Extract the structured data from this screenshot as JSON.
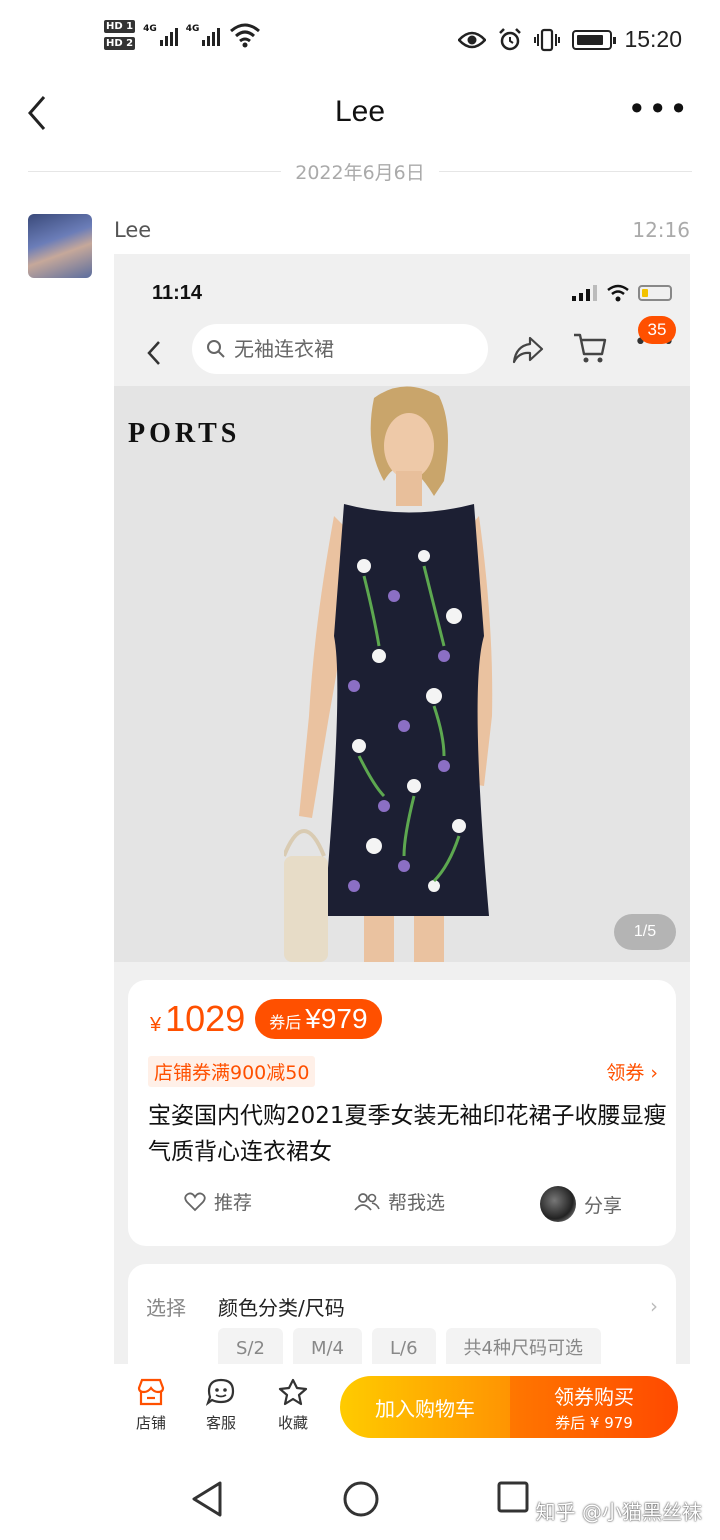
{
  "status_bar": {
    "hd1": "HD 1",
    "hd2": "HD 2",
    "net1": "4G",
    "net2": "4G",
    "time": "15:20",
    "icons": [
      "eye-icon",
      "alarm-icon",
      "vibrate-icon",
      "battery-icon"
    ]
  },
  "chat": {
    "title": "Lee",
    "date_divider": "2022年6月6日",
    "sender": "Lee",
    "message_time": "12:16"
  },
  "shared_screenshot": {
    "status_time": "11:14",
    "search_placeholder": "无袖连衣裙",
    "cart_badge": "35",
    "brand_logo": "PORTS",
    "image_counter": "1/5",
    "price_currency": "¥",
    "price": "1029",
    "coupon_prefix": "券后",
    "coupon_price": "¥979",
    "store_coupon": "店铺券满900减50",
    "get_coupon": "领券 ›",
    "product_title": "宝姿国内代购2021夏季女装无袖印花裙子收腰显瘦气质背心连衣裙女",
    "actions": {
      "recommend": "推荐",
      "help_choose": "帮我选",
      "share": "分享"
    },
    "options": {
      "label": "选择",
      "value": "颜色分类/尺码",
      "sizes": [
        "S/2",
        "M/4",
        "L/6",
        "共4种尺码可选"
      ]
    },
    "bottom_bar": {
      "store": "店铺",
      "service": "客服",
      "favorite": "收藏",
      "add_to_cart": "加入购物车",
      "buy_label": "领券购买",
      "buy_sub": "券后 ¥ 979"
    }
  },
  "watermark": "知乎 @小猫黑丝袜",
  "colors": {
    "accent_orange": "#ff5000",
    "cart_button_start": "#ffcb00",
    "buy_button_end": "#ff4900"
  }
}
